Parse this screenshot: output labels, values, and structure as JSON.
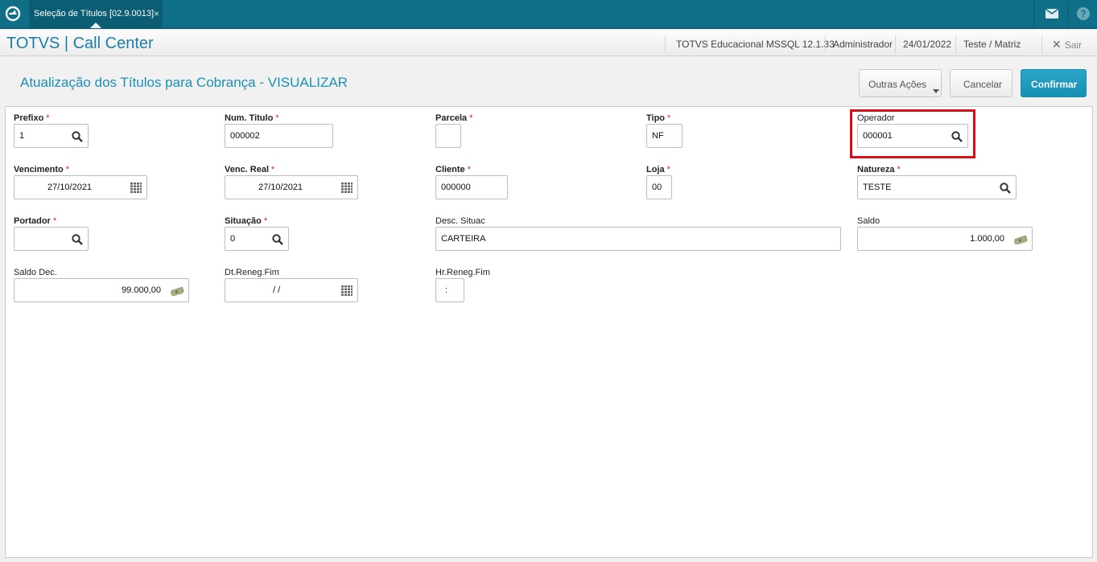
{
  "tab": {
    "title": "Seleção de Títulos [02.9.0013]",
    "close": "×"
  },
  "header": {
    "app_title": "TOTVS | Call Center",
    "environment": "TOTVS Educacional MSSQL 12.1.33",
    "user": "Administrador",
    "date": "24/01/2022",
    "branch": "Teste / Matriz",
    "exit_label": "Sair"
  },
  "page": {
    "title": "Atualização dos Títulos para Cobrança - VISUALIZAR"
  },
  "buttons": {
    "other_actions": "Outras Ações",
    "cancel": "Cancelar",
    "confirm": "Confirmar"
  },
  "fields": {
    "prefixo": {
      "label": "Prefixo",
      "required": "*",
      "value": "1"
    },
    "num_titulo": {
      "label": "Num. Titulo",
      "required": "*",
      "value": "000002"
    },
    "parcela": {
      "label": "Parcela",
      "required": "*",
      "value": ""
    },
    "tipo": {
      "label": "Tipo",
      "required": "*",
      "value": "NF"
    },
    "operador": {
      "label": "Operador",
      "value": "000001"
    },
    "vencimento": {
      "label": "Vencimento",
      "required": "*",
      "value": "27/10/2021"
    },
    "venc_real": {
      "label": "Venc. Real",
      "required": "*",
      "value": "27/10/2021"
    },
    "cliente": {
      "label": "Cliente",
      "required": "*",
      "value": "000000"
    },
    "loja": {
      "label": "Loja",
      "required": "*",
      "value": "00"
    },
    "natureza": {
      "label": "Natureza",
      "required": "*",
      "value": "TESTE"
    },
    "portador": {
      "label": "Portador",
      "required": "*",
      "value": ""
    },
    "situacao": {
      "label": "Situação",
      "required": "*",
      "value": "0"
    },
    "desc_situac": {
      "label": "Desc. Situac",
      "value": "CARTEIRA"
    },
    "saldo": {
      "label": "Saldo",
      "value": "1.000,00"
    },
    "saldo_dec": {
      "label": "Saldo Dec.",
      "value": "99.000,00"
    },
    "dt_reneg_fim": {
      "label": "Dt.Reneg.Fim",
      "value": "/ /"
    },
    "hr_reneg_fim": {
      "label": "Hr.Reneg.Fim",
      "value": ":"
    }
  },
  "colors": {
    "topbar": "#0e6f86",
    "accent": "#1b8fb5",
    "confirm": "#1a9bc0",
    "required": "#d32222",
    "highlight": "#d5101a"
  }
}
